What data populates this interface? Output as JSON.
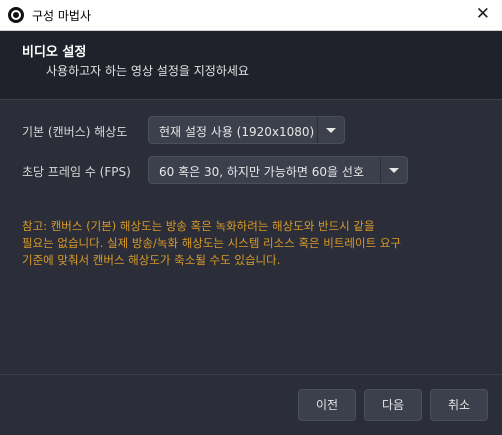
{
  "window": {
    "title": "구성 마법사",
    "close_glyph": "✕"
  },
  "header": {
    "title": "비디오 설정",
    "subtitle": "사용하고자 하는 영상 설정을 지정하세요"
  },
  "settings": {
    "base_resolution": {
      "label": "기본 (캔버스) 해상도",
      "value": "현재 설정 사용 (1920x1080)"
    },
    "fps": {
      "label": "초당 프레임 수 (FPS)",
      "value": "60 혹은 30, 하지만 가능하면 60을 선호"
    }
  },
  "note": {
    "lines": [
      "참고: 캔버스 (기본) 해상도는 방송 혹은 녹화하려는 해상도와 반드시 같을",
      "필요는 없습니다. 실제 방송/녹화 해상도는 시스템 리소스 혹은 비트레이트 요구",
      "기준에 맞춰서 캔버스 해상도가 축소될 수도 있습니다."
    ]
  },
  "buttons": {
    "back": "이전",
    "next": "다음",
    "cancel": "취소"
  },
  "colors": {
    "background": "#2b2e38",
    "header_bg": "#1f222b",
    "note": "#d99a28",
    "control": "#3c404d"
  }
}
